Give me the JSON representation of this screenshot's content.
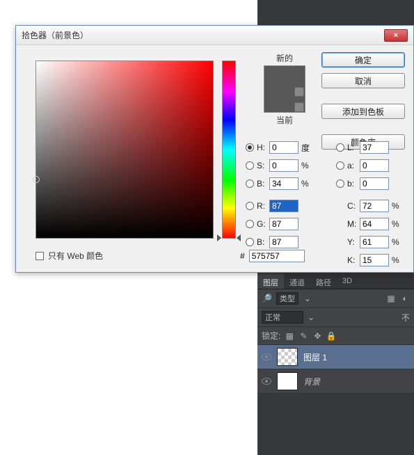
{
  "dialog": {
    "title": "拾色器（前景色）",
    "close": "×",
    "preview": {
      "new": "新的",
      "current": "当前"
    },
    "buttons": {
      "ok": "确定",
      "cancel": "取消",
      "add_swatch": "添加到色板",
      "color_lib": "颜色库"
    },
    "hsb": {
      "h": {
        "label": "H:",
        "value": "0",
        "unit": "度",
        "checked": true
      },
      "s": {
        "label": "S:",
        "value": "0",
        "unit": "%"
      },
      "b": {
        "label": "B:",
        "value": "34",
        "unit": "%"
      }
    },
    "rgb": {
      "r": {
        "label": "R:",
        "value": "87",
        "selected": true
      },
      "g": {
        "label": "G:",
        "value": "87"
      },
      "b": {
        "label": "B:",
        "value": "87"
      }
    },
    "lab": {
      "l": {
        "label": "L:",
        "value": "37"
      },
      "a": {
        "label": "a:",
        "value": "0"
      },
      "b": {
        "label": "b:",
        "value": "0"
      }
    },
    "cmyk": {
      "c": {
        "label": "C:",
        "value": "72",
        "unit": "%"
      },
      "m": {
        "label": "M:",
        "value": "64",
        "unit": "%"
      },
      "y": {
        "label": "Y:",
        "value": "61",
        "unit": "%"
      },
      "k": {
        "label": "K:",
        "value": "15",
        "unit": "%"
      }
    },
    "hex": {
      "prefix": "#",
      "value": "575757"
    },
    "web_only": "只有 Web 颜色",
    "current_color": "#575757"
  },
  "layers": {
    "tabs": [
      "图层",
      "通道",
      "路径",
      "3D"
    ],
    "type_filter": "类型",
    "blend_mode": "正常",
    "opacity_label": "不",
    "lock_label": "锁定:",
    "items": [
      {
        "name": "图层 1",
        "active": true,
        "checker": true
      },
      {
        "name": "背景",
        "active": false,
        "checker": false
      }
    ]
  }
}
